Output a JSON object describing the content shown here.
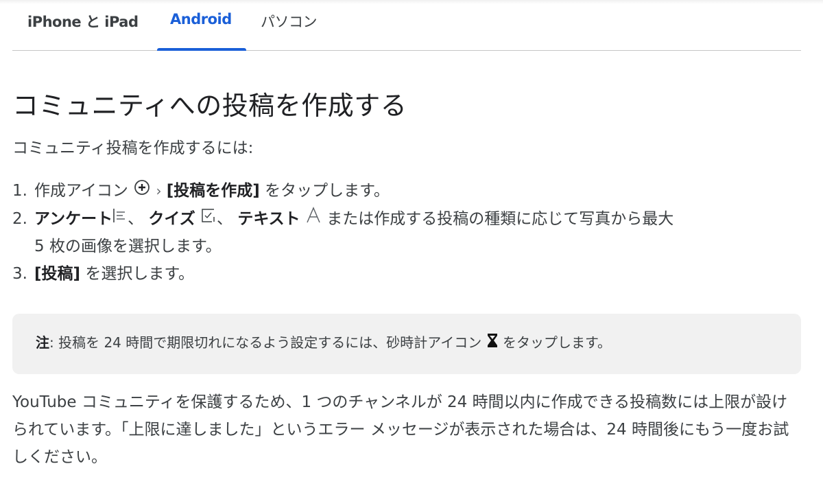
{
  "tabs": [
    {
      "label": "iPhone と iPad",
      "active": false
    },
    {
      "label": "Android",
      "active": true
    },
    {
      "label": "パソコン",
      "active": false
    }
  ],
  "colors": {
    "accent": "#1a5fd8",
    "note_bg": "#f1f1f1",
    "text": "#3c4043"
  },
  "article": {
    "title": "コミュニティへの投稿を作成する",
    "intro": "コミュニティ投稿を作成するには:",
    "steps": [
      {
        "num": "1.",
        "text_a": "作成アイコン",
        "icon": "add-circle-icon",
        "separator": "›",
        "bold": "[投稿を作成]",
        "text_b": "をタップします。"
      },
      {
        "num": "2.",
        "bold_a": "アンケート",
        "icon_a": "poll-icon",
        "sep_a": "、",
        "bold_b": "クイズ",
        "icon_b": "quiz-icon",
        "sep_b": "、",
        "bold_c": "テキスト",
        "icon_c": "text-icon",
        "text": "または作成する投稿の種類に応じて写真から最大",
        "text_cont": "5 枚の画像を選択します。"
      },
      {
        "num": "3.",
        "bold": "[投稿]",
        "text": "を選択します。"
      }
    ],
    "note": {
      "label": "注",
      "text_a": ": 投稿を 24 時間で期限切れになるよう設定するには、砂時計アイコン",
      "icon": "hourglass-icon",
      "text_b": "をタップします。"
    },
    "paragraph": "YouTube コミュニティを保護するため、1 つのチャンネルが 24 時間以内に作成できる投稿数には上限が設けられています。「上限に達しました」というエラー メッセージが表示された場合は、24 時間後にもう一度お試しください。"
  }
}
